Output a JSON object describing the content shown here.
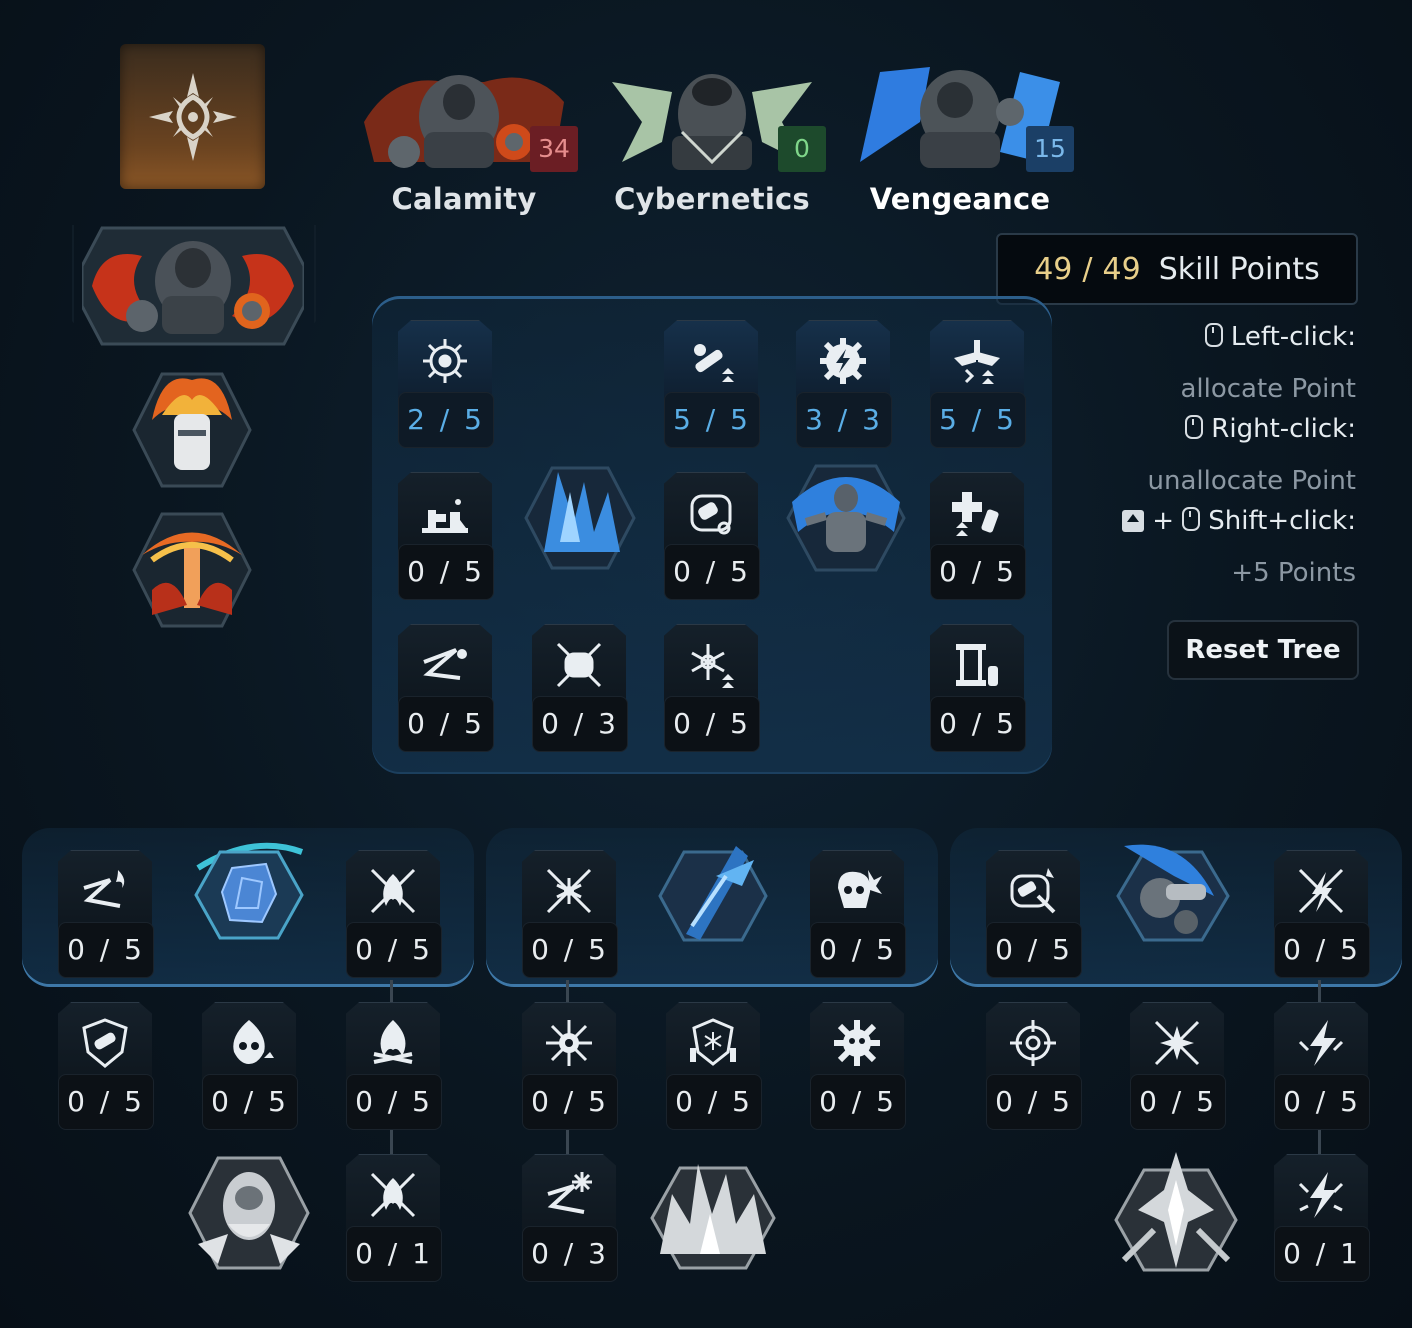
{
  "trees": [
    {
      "name": "Calamity",
      "points": "34",
      "color": "#6b1e24",
      "art": "calamity-portrait",
      "active": false
    },
    {
      "name": "Cybernetics",
      "points": "0",
      "color": "#1d4a2c",
      "art": "cybernetics-portrait",
      "active": false
    },
    {
      "name": "Vengeance",
      "points": "15",
      "color": "#1b3f66",
      "art": "vengeance-portrait",
      "active": true
    }
  ],
  "skill_points": {
    "current": "49",
    "separator": "/",
    "total": "49",
    "label": "Skill Points"
  },
  "help": {
    "left_click_title": "Left-click:",
    "left_click_desc": "allocate Point",
    "right_click_title": "Right-click:",
    "right_click_desc": "unallocate Point",
    "shift_plus": "+",
    "shift_click_title": "Shift+click:",
    "shift_click_desc": "+5 Points"
  },
  "reset_label": "Reset Tree",
  "main_nodes": [
    {
      "id": "n1",
      "count": "2 / 5",
      "icon": "gear-target-icon",
      "active": true
    },
    {
      "id": "n2",
      "count": "5 / 5",
      "icon": "grenade-arrows-icon",
      "active": true
    },
    {
      "id": "n3",
      "count": "3 / 3",
      "icon": "cog-bolt-icon",
      "active": true
    },
    {
      "id": "n4",
      "count": "5 / 5",
      "icon": "winged-arrows-icon",
      "active": true
    },
    {
      "id": "n5",
      "count": "0 / 5",
      "icon": "turret-icon",
      "active": false
    },
    {
      "id": "n6",
      "count": "0 / 5",
      "icon": "grenade-gear-icon",
      "active": false
    },
    {
      "id": "n7",
      "count": "0 / 5",
      "icon": "medkit-bottle-icon",
      "active": false
    },
    {
      "id": "n8",
      "count": "0 / 5",
      "icon": "zigzag-dot-icon",
      "active": false
    },
    {
      "id": "n9",
      "count": "0 / 3",
      "icon": "crossed-grenade-icon",
      "active": false
    },
    {
      "id": "n10",
      "count": "0 / 5",
      "icon": "snowflake-arrows-icon",
      "active": false
    },
    {
      "id": "n11",
      "count": "0 / 5",
      "icon": "station-bottle-icon",
      "active": false
    }
  ],
  "sub_nodes": [
    {
      "id": "a1",
      "count": "0 / 5",
      "icon": "zigzag-flame-icon"
    },
    {
      "id": "a2",
      "count": "0 / 5",
      "icon": "crossed-flame-icon"
    },
    {
      "id": "a3",
      "count": "0 / 5",
      "icon": "shield-grenade-icon"
    },
    {
      "id": "a4",
      "count": "0 / 5",
      "icon": "skull-flame-icon"
    },
    {
      "id": "a5",
      "count": "0 / 5",
      "icon": "campfire-icon"
    },
    {
      "id": "a6",
      "count": "0 / 1",
      "icon": "crossed-flame-small-icon"
    },
    {
      "id": "b1",
      "count": "0 / 5",
      "icon": "crossed-snowflake-icon"
    },
    {
      "id": "b2",
      "count": "0 / 5",
      "icon": "skull-burst-icon"
    },
    {
      "id": "b3",
      "count": "0 / 5",
      "icon": "snowflake-burst-icon"
    },
    {
      "id": "b4",
      "count": "0 / 5",
      "icon": "shield-snowflake-icon"
    },
    {
      "id": "b5",
      "count": "0 / 5",
      "icon": "skull-gear-icon"
    },
    {
      "id": "b6",
      "count": "0 / 3",
      "icon": "zigzag-snowflake-icon"
    },
    {
      "id": "c1",
      "count": "0 / 5",
      "icon": "grenade-spark-icon"
    },
    {
      "id": "c2",
      "count": "0 / 5",
      "icon": "crossed-bolt-icon"
    },
    {
      "id": "c3",
      "count": "0 / 5",
      "icon": "crosshair-icon"
    },
    {
      "id": "c4",
      "count": "0 / 5",
      "icon": "starburst-icon"
    },
    {
      "id": "c5",
      "count": "0 / 5",
      "icon": "lightning-icon"
    },
    {
      "id": "c6",
      "count": "0 / 1",
      "icon": "lightning-burst-icon"
    }
  ]
}
